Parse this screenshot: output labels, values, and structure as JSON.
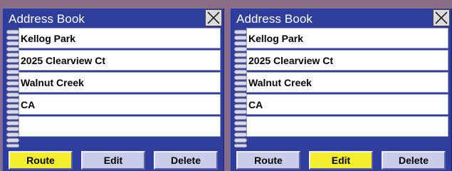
{
  "panels": [
    {
      "title": "Address Book",
      "entries": [
        "Kellog Park",
        "2025 Clearview Ct",
        "Walnut Creek",
        "CA",
        ""
      ],
      "buttons": {
        "route": "Route",
        "edit": "Edit",
        "delete": "Delete"
      },
      "active_button": "route"
    },
    {
      "title": "Address Book",
      "entries": [
        "Kellog Park",
        "2025 Clearview Ct",
        "Walnut Creek",
        "CA",
        ""
      ],
      "buttons": {
        "route": "Route",
        "edit": "Edit",
        "delete": "Delete"
      },
      "active_button": "edit"
    }
  ],
  "colors": {
    "panel_bg": "#2f3e9c",
    "button_bg": "#c9cde9",
    "button_active": "#f5ee2c",
    "row_bg": "#ffffff"
  },
  "icons": {
    "close": "close-icon",
    "spine": "spiral-binding-icon"
  }
}
